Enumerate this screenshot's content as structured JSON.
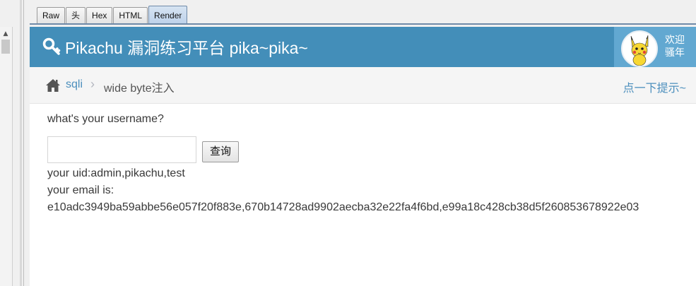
{
  "tabs": [
    "Raw",
    "头",
    "Hex",
    "HTML",
    "Render"
  ],
  "active_tab": "Render",
  "navbar": {
    "title": "Pikachu 漏洞练习平台 pika~pika~",
    "welcome_line1": "欢迎",
    "welcome_line2": "骚年"
  },
  "breadcrumbs": {
    "parent": "sqli",
    "separator": "›",
    "current": "wide byte注入",
    "hint": "点一下提示~"
  },
  "form": {
    "question": "what's your username?",
    "input_value": "",
    "button_label": "查询"
  },
  "result": {
    "uid_line": "your uid:admin,pikachu,test",
    "email_label": "your email is:",
    "email_values": "e10adc3949ba59abbe56e057f20f883e,670b14728ad9902aecba32e22fa4f6bd,e99a18c428cb38d5f260853678922e03"
  },
  "colors": {
    "navbar": "#438eb9",
    "userbox": "#62a8d1",
    "link": "#4c8fbd"
  },
  "icons": [
    "key-icon",
    "home-icon",
    "pikachu-avatar"
  ]
}
